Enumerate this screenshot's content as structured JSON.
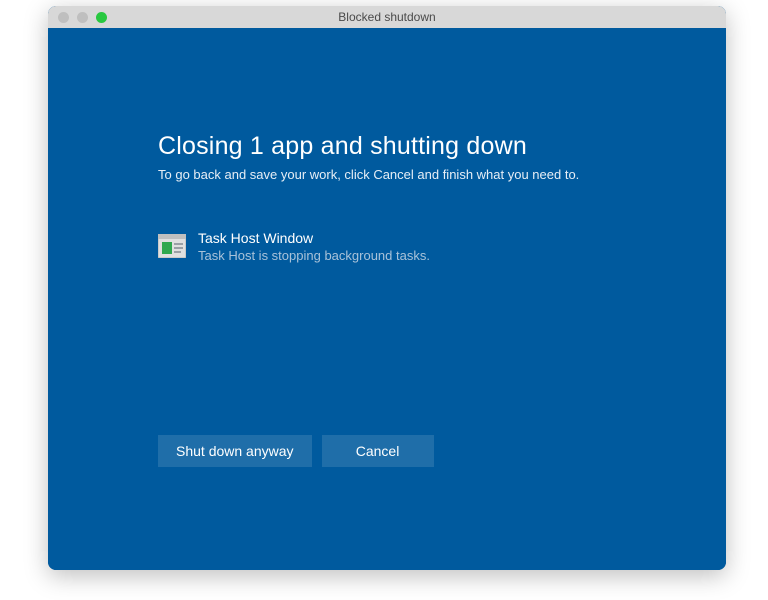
{
  "window": {
    "title": "Blocked shutdown"
  },
  "main": {
    "heading": "Closing 1 app and shutting down",
    "subheading": "To go back and save your work, click Cancel and finish what you need to."
  },
  "blocking_app": {
    "name": "Task Host Window",
    "status": "Task Host is stopping background tasks."
  },
  "buttons": {
    "shutdown_anyway": "Shut down anyway",
    "cancel": "Cancel"
  }
}
